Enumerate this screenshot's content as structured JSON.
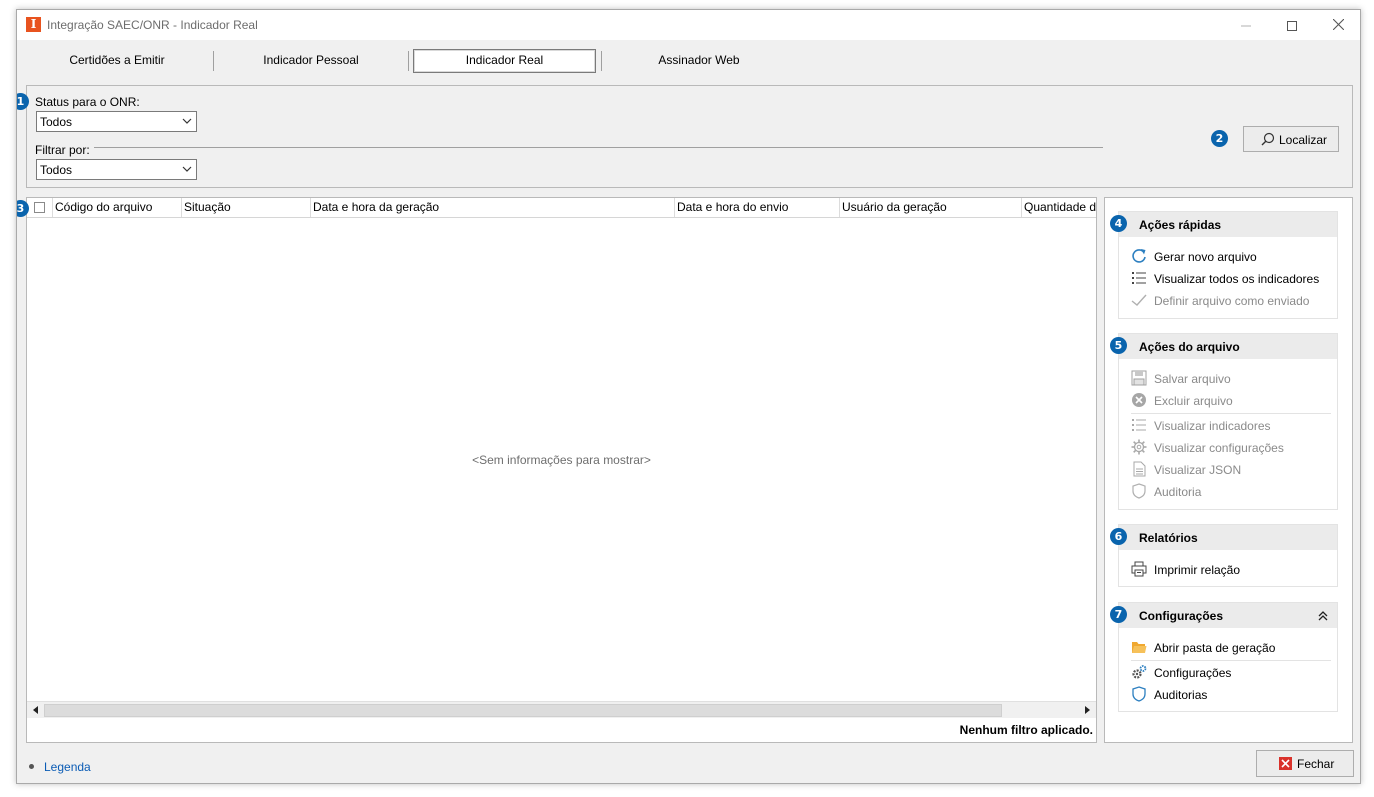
{
  "window": {
    "title": "Integração SAEC/ONR - Indicador Real",
    "app_icon_letter": "I"
  },
  "tabs": [
    {
      "label": "Certidões a Emitir",
      "active": false
    },
    {
      "label": "Indicador Pessoal",
      "active": false
    },
    {
      "label": "Indicador Real",
      "active": true
    },
    {
      "label": "Assinador Web",
      "active": false
    }
  ],
  "filters": {
    "badge_1": "1",
    "badge_2": "2",
    "status_label": "Status para o ONR:",
    "status_value": "Todos",
    "filter_label": "Filtrar por:",
    "filter_value": "Todos",
    "localizar_label": "Localizar"
  },
  "grid": {
    "badge": "3",
    "columns": [
      "Código do arquivo",
      "Situação",
      "Data e hora da geração",
      "Data e hora do envio",
      "Usuário da geração",
      "Quantidade de"
    ],
    "empty_message": "<Sem informações para mostrar>",
    "status_text": "Nenhum filtro aplicado."
  },
  "side": {
    "quick": {
      "badge": "4",
      "title": "Ações rápidas",
      "items": [
        {
          "label": "Gerar novo arquivo",
          "icon": "refresh-icon",
          "enabled": true
        },
        {
          "label": "Visualizar todos os indicadores",
          "icon": "list-icon",
          "enabled": true
        },
        {
          "label": "Definir arquivo como enviado",
          "icon": "check-icon",
          "enabled": false
        }
      ]
    },
    "file": {
      "badge": "5",
      "title": "Ações do arquivo",
      "items": [
        {
          "label": "Salvar arquivo",
          "icon": "save-icon",
          "enabled": false
        },
        {
          "label": "Excluir arquivo",
          "icon": "delete-icon",
          "enabled": false
        },
        {
          "label": "Visualizar indicadores",
          "icon": "list-icon",
          "enabled": false
        },
        {
          "label": "Visualizar configurações",
          "icon": "gear-icon",
          "enabled": false
        },
        {
          "label": "Visualizar JSON",
          "icon": "document-icon",
          "enabled": false
        },
        {
          "label": "Auditoria",
          "icon": "shield-icon",
          "enabled": false
        }
      ]
    },
    "reports": {
      "badge": "6",
      "title": "Relatórios",
      "items": [
        {
          "label": "Imprimir relação",
          "icon": "printer-icon",
          "enabled": true
        }
      ]
    },
    "config": {
      "badge": "7",
      "title": "Configurações",
      "items": [
        {
          "label": "Abrir pasta de geração",
          "icon": "folder-icon",
          "enabled": true
        },
        {
          "label": "Configurações",
          "icon": "gears-icon",
          "enabled": true
        },
        {
          "label": "Auditorias",
          "icon": "shield-icon",
          "enabled": true
        }
      ]
    }
  },
  "footer": {
    "legend_label": "Legenda",
    "close_label": "Fechar"
  },
  "colors": {
    "badge": "#0a64ad",
    "link": "#0b5cb5",
    "app_icon": "#e8531f",
    "close_icon": "#d9322b",
    "folder": "#f0a830"
  }
}
